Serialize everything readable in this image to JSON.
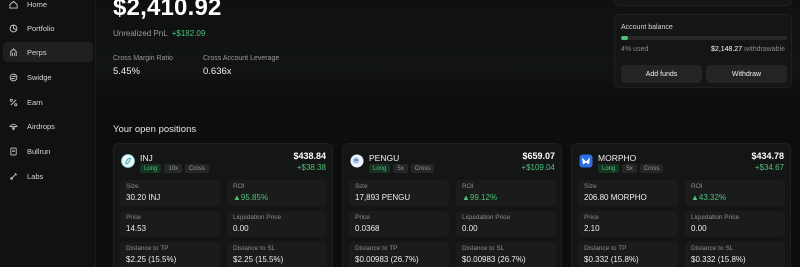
{
  "sidebar": {
    "items": [
      {
        "label": "Home",
        "icon": "home-icon"
      },
      {
        "label": "Portfolio",
        "icon": "portfolio-icon"
      },
      {
        "label": "Perps",
        "icon": "perps-icon",
        "active": true
      },
      {
        "label": "Swidge",
        "icon": "swap-icon"
      },
      {
        "label": "Earn",
        "icon": "percent-icon"
      },
      {
        "label": "Airdrops",
        "icon": "gift-icon"
      },
      {
        "label": "Bullrun",
        "icon": "book-icon"
      },
      {
        "label": "Labs",
        "icon": "labs-icon"
      }
    ]
  },
  "header": {
    "balance": "$2,410.92",
    "pnl_label": "Unrealized PnL",
    "pnl_value": "+$182.09",
    "margin_ratio_label": "Cross Margin Ratio",
    "margin_ratio_value": "5.45%",
    "leverage_label": "Cross Account Leverage",
    "leverage_value": "0.636x"
  },
  "account": {
    "title": "Account balance",
    "used_pct": 0.04,
    "used_text": "4% used",
    "withdrawable_amount": "$2,148.27",
    "withdrawable_label": "withdrawable",
    "add_funds_label": "Add funds",
    "withdraw_label": "Withdraw"
  },
  "positions_title": "Your open positions",
  "positions": [
    {
      "symbol": "INJ",
      "side": "Long",
      "leverage": "10x",
      "mode": "Cross",
      "value": "$438.84",
      "pnl": "+$38.38",
      "size_label": "Size",
      "size": "30.20 INJ",
      "roi_label": "ROI",
      "roi": "95.85%",
      "price_label": "Price",
      "price": "14.53",
      "liq_label": "Liquidation Price",
      "liq": "0.00",
      "tp_label": "Distance to TP",
      "tp": "$2.25 (15.5%)",
      "sl_label": "Distance to SL",
      "sl": "$2.25 (15.5%)",
      "color": "#7fd3d8"
    },
    {
      "symbol": "PENGU",
      "side": "Long",
      "leverage": "5x",
      "mode": "Cross",
      "value": "$659.07",
      "pnl": "+$109.04",
      "size_label": "Size",
      "size": "17,893 PENGU",
      "roi_label": "ROI",
      "roi": "99.12%",
      "price_label": "Price",
      "price": "0.0368",
      "liq_label": "Liquidation Price",
      "liq": "0.00",
      "tp_label": "Distance to TP",
      "tp": "$0.00983 (26.7%)",
      "sl_label": "Distance to SL",
      "sl": "$0.00983 (26.7%)",
      "color": "#9ec6f0"
    },
    {
      "symbol": "MORPHO",
      "side": "Long",
      "leverage": "5x",
      "mode": "Cross",
      "value": "$434.78",
      "pnl": "+$34.67",
      "size_label": "Size",
      "size": "206.80 MORPHO",
      "roi_label": "ROI",
      "roi": "43.32%",
      "price_label": "Price",
      "price": "2.10",
      "liq_label": "Liquidation Price",
      "liq": "0.00",
      "tp_label": "Distance to TP",
      "tp": "$0.332 (15.8%)",
      "sl_label": "Distance to SL",
      "sl": "$0.332 (15.8%)",
      "color": "#2d6fe0"
    }
  ],
  "colors": {
    "accent_green": "#4ec27a",
    "background": "#0c0d0d",
    "card": "#141515"
  }
}
